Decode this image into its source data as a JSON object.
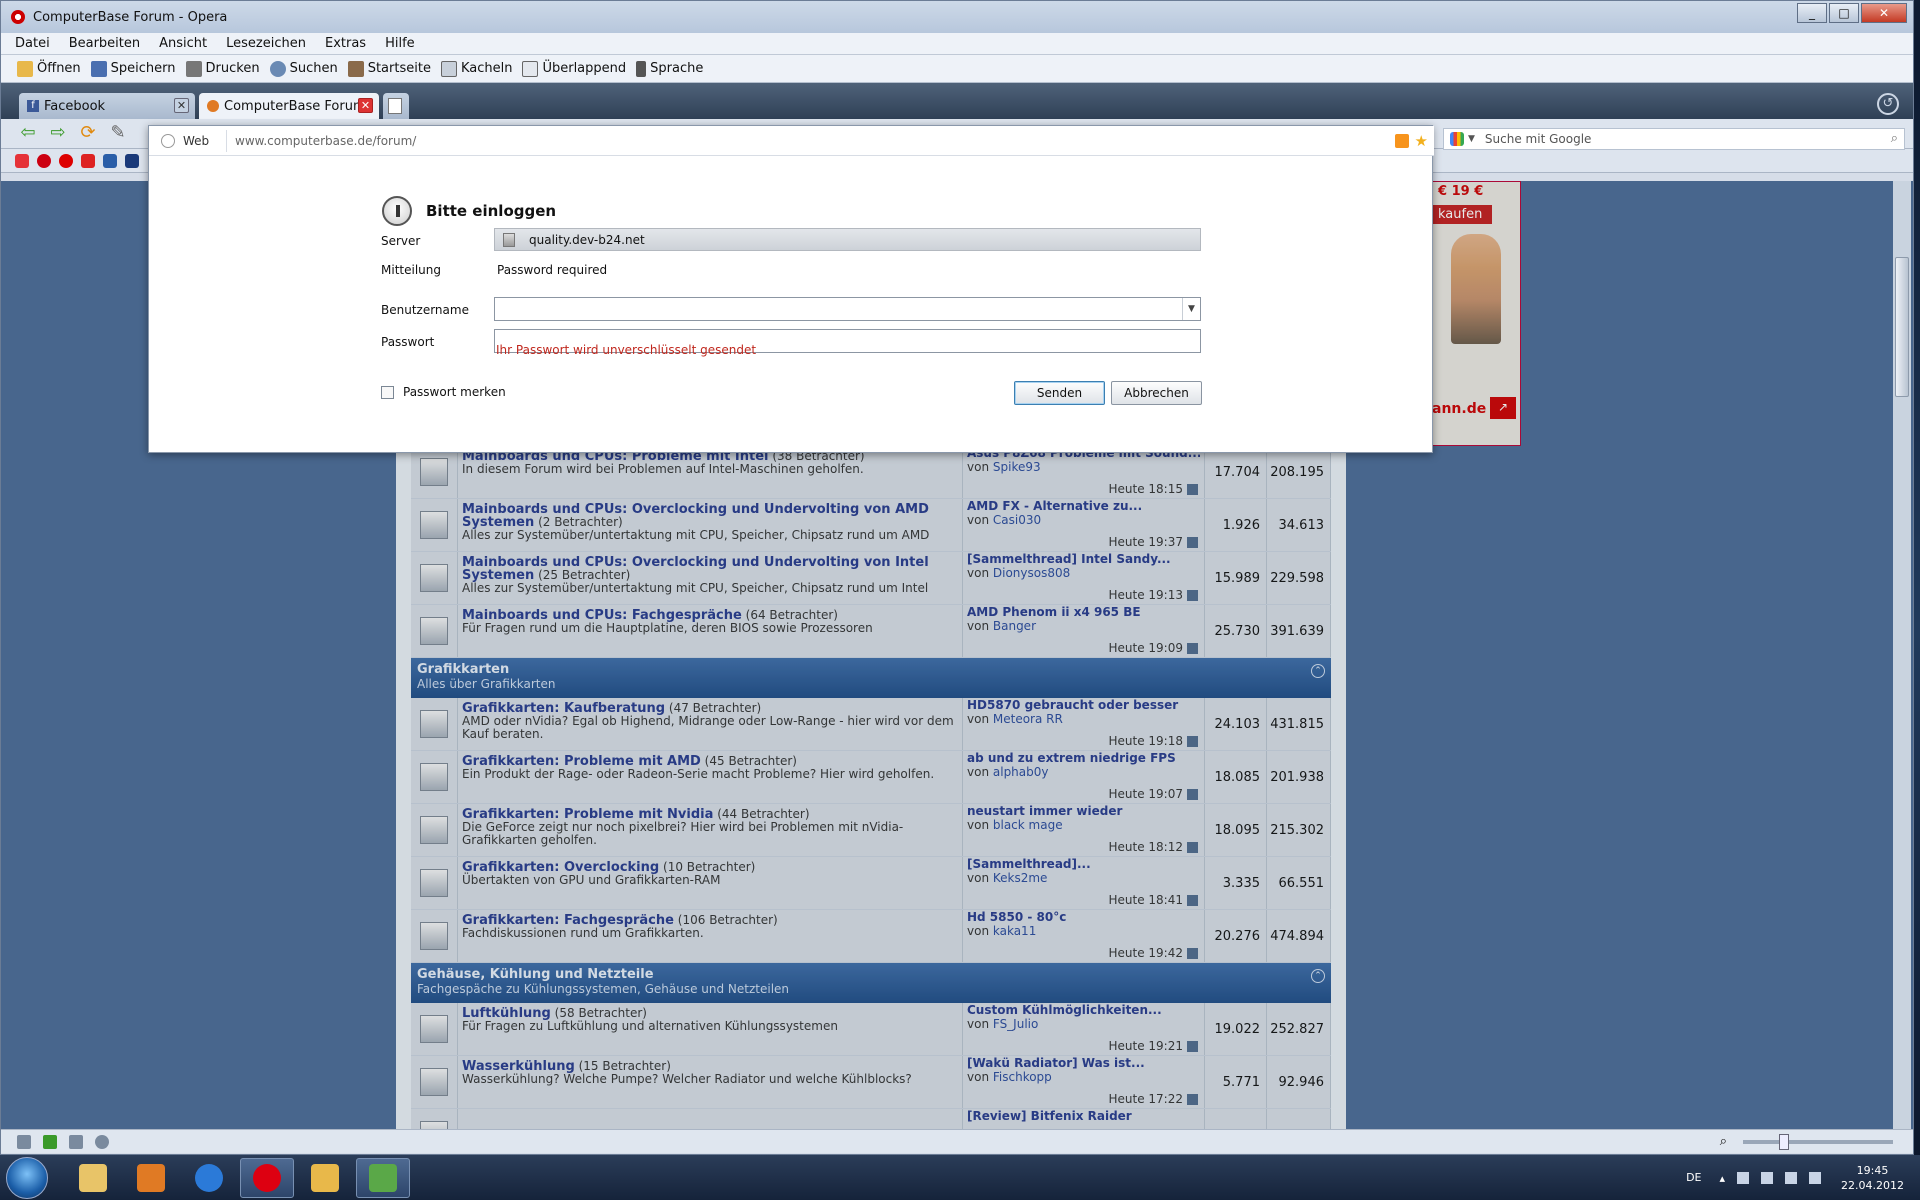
{
  "window": {
    "title": "ComputerBase Forum - Opera"
  },
  "menubar": [
    "Datei",
    "Bearbeiten",
    "Ansicht",
    "Lesezeichen",
    "Extras",
    "Hilfe"
  ],
  "toolbar": [
    "Öffnen",
    "Speichern",
    "Drucken",
    "Suchen",
    "Startseite",
    "Kacheln",
    "Überlappend",
    "Sprache"
  ],
  "tabs": [
    {
      "label": "Facebook",
      "active": false
    },
    {
      "label": "ComputerBase Forum",
      "active": true
    }
  ],
  "address": {
    "mode": "Web",
    "url": "www.computerbase.de/forum/"
  },
  "search": {
    "placeholder": "Suche mit Google"
  },
  "ad": {
    "price": "€ 19 €",
    "buy": "kaufen",
    "brand": "ann.de"
  },
  "dialog": {
    "title": "Bitte einloggen",
    "server_label": "Server",
    "server_value": "quality.dev-b24.net",
    "message_label": "Mitteilung",
    "message_value": "Password required",
    "username_label": "Benutzername",
    "username_value": "",
    "password_label": "Passwort",
    "password_value": "",
    "warning": "Ihr Passwort wird unverschlüsselt gesendet",
    "remember_label": "Passwort merken",
    "send": "Senden",
    "cancel": "Abbrechen"
  },
  "forum": [
    {
      "type": "row",
      "title": "Mainboards und CPUs: Probleme mit Intel",
      "viewers": "(38 Betrachter)",
      "desc": "In diesem Forum wird bei Problemen auf Intel-Maschinen geholfen.",
      "last_title": "Asus P8Z68 Probleme mit Sound...",
      "by": "Spike93",
      "time": "Heute 18:15",
      "threads": "17.704",
      "posts": "208.195"
    },
    {
      "type": "row",
      "title": "Mainboards und CPUs: Overclocking und Undervolting von AMD Systemen",
      "viewers": "(2 Betrachter)",
      "desc": "Alles zur Systemüber/untertaktung mit CPU, Speicher, Chipsatz rund um AMD",
      "last_title": "AMD FX - Alternative zu...",
      "by": "Casi030",
      "time": "Heute 19:37",
      "threads": "1.926",
      "posts": "34.613"
    },
    {
      "type": "row",
      "title": "Mainboards und CPUs: Overclocking und Undervolting von Intel Systemen",
      "viewers": "(25 Betrachter)",
      "desc": "Alles zur Systemüber/untertaktung mit CPU, Speicher, Chipsatz rund um Intel",
      "last_title": "[Sammelthread] Intel Sandy...",
      "by": "Dionysos808",
      "time": "Heute 19:13",
      "threads": "15.989",
      "posts": "229.598"
    },
    {
      "type": "row",
      "title": "Mainboards und CPUs: Fachgespräche",
      "viewers": "(64 Betrachter)",
      "desc": "Für Fragen rund um die Hauptplatine, deren BIOS sowie Prozessoren",
      "last_title": "AMD Phenom ii x4 965 BE",
      "by": "Banger",
      "time": "Heute 19:09",
      "threads": "25.730",
      "posts": "391.639"
    },
    {
      "type": "cat",
      "title": "Grafikkarten",
      "sub": "Alles über Grafikkarten"
    },
    {
      "type": "row",
      "title": "Grafikkarten: Kaufberatung",
      "viewers": "(47 Betrachter)",
      "desc": "AMD oder nVidia? Egal ob Highend, Midrange oder Low-Range - hier wird vor dem Kauf beraten.",
      "last_title": "HD5870 gebraucht oder besser",
      "by": "Meteora RR",
      "time": "Heute 19:18",
      "threads": "24.103",
      "posts": "431.815"
    },
    {
      "type": "row",
      "title": "Grafikkarten: Probleme mit AMD",
      "viewers": "(45 Betrachter)",
      "desc": "Ein Produkt der Rage- oder Radeon-Serie macht Probleme? Hier wird geholfen.",
      "last_title": "ab und zu extrem niedrige FPS",
      "by": "alphab0y",
      "time": "Heute 19:07",
      "threads": "18.085",
      "posts": "201.938"
    },
    {
      "type": "row",
      "title": "Grafikkarten: Probleme mit Nvidia",
      "viewers": "(44 Betrachter)",
      "desc": "Die GeForce zeigt nur noch pixelbrei? Hier wird bei Problemen mit nVidia-Grafikkarten geholfen.",
      "last_title": "neustart immer wieder",
      "by": "black mage",
      "time": "Heute 18:12",
      "threads": "18.095",
      "posts": "215.302"
    },
    {
      "type": "row",
      "title": "Grafikkarten: Overclocking",
      "viewers": "(10 Betrachter)",
      "desc": "Übertakten von GPU und Grafikkarten-RAM",
      "last_title": "[Sammelthread]...",
      "by": "Keks2me",
      "time": "Heute 18:41",
      "threads": "3.335",
      "posts": "66.551"
    },
    {
      "type": "row",
      "title": "Grafikkarten: Fachgespräche",
      "viewers": "(106 Betrachter)",
      "desc": "Fachdiskussionen rund um Grafikkarten.",
      "last_title": "Hd 5850 - 80°c",
      "by": "kaka11",
      "time": "Heute 19:42",
      "threads": "20.276",
      "posts": "474.894"
    },
    {
      "type": "cat",
      "title": "Gehäuse, Kühlung und Netzteile",
      "sub": "Fachgespäche zu Kühlungssystemen, Gehäuse und Netzteilen"
    },
    {
      "type": "row",
      "title": "Luftkühlung",
      "viewers": "(58 Betrachter)",
      "desc": "Für Fragen zu Luftkühlung und alternativen Kühlungssystemen",
      "last_title": "Custom Kühlmöglichkeiten...",
      "by": "FS_Julio",
      "time": "Heute 19:21",
      "threads": "19.022",
      "posts": "252.827"
    },
    {
      "type": "row",
      "title": "Wasserkühlung",
      "viewers": "(15 Betrachter)",
      "desc": "Wasserkühlung? Welche Pumpe? Welcher Radiator und welche Kühlblocks?",
      "last_title": "[Wakü Radiator] Was ist...",
      "by": "Fischkopp",
      "time": "Heute 17:22",
      "threads": "5.771",
      "posts": "92.946"
    },
    {
      "type": "row",
      "title": "",
      "viewers": "",
      "desc": "",
      "last_title": "[Review] Bitfenix Raider",
      "by": "",
      "time": "",
      "threads": "",
      "posts": ""
    }
  ],
  "tray": {
    "lang": "DE",
    "time": "19:45",
    "date": "22.04.2012"
  }
}
